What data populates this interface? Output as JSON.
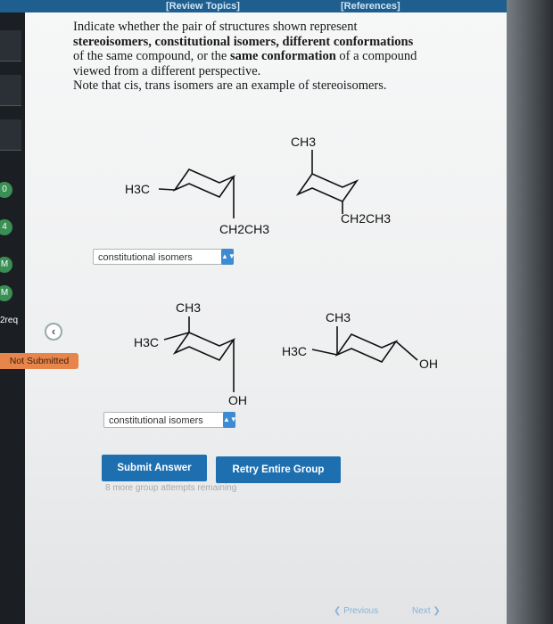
{
  "topbar": {
    "review_topics": "[Review Topics]",
    "references": "[References]"
  },
  "sidebar": {
    "circles": [
      "0",
      "4",
      "M",
      "M"
    ],
    "prereq": "2req",
    "not_submitted": "Not Submitted"
  },
  "question": {
    "line1": "Indicate whether the pair of structures shown represent",
    "stereo": "stereoisomers",
    "sep1": ", ",
    "const": "constitutional isomers",
    "sep2": ", ",
    "diffconf": "different conformations",
    "line3a": "of the same compound, or the",
    "sameconf": "same conformation",
    "line3b": "of a compound",
    "line4": "viewed from a different perspective.",
    "line5": "Note that cis, trans isomers are an example of stereoisomers."
  },
  "pair1": {
    "left_sub1": "H3C",
    "left_sub2": "CH2CH3",
    "right_sub1": "CH3",
    "right_sub2": "CH2CH3",
    "answer": "constitutional isomers"
  },
  "pair2": {
    "left_sub1": "CH3",
    "left_sub2": "H3C",
    "left_sub3": "OH",
    "right_sub1": "CH3",
    "right_sub2": "H3C",
    "right_sub3": "OH",
    "answer": "constitutional isomers"
  },
  "actions": {
    "submit": "Submit Answer",
    "retry": "Retry Entire Group",
    "attempts": "8 more group attempts remaining"
  },
  "nav": {
    "previous": "Previous",
    "next": "Next"
  },
  "colors": {
    "topbar": "#1f5f8f",
    "button": "#1e6fb0",
    "not_submitted": "#e8854a",
    "select_arrow": "#3d8bd1"
  }
}
